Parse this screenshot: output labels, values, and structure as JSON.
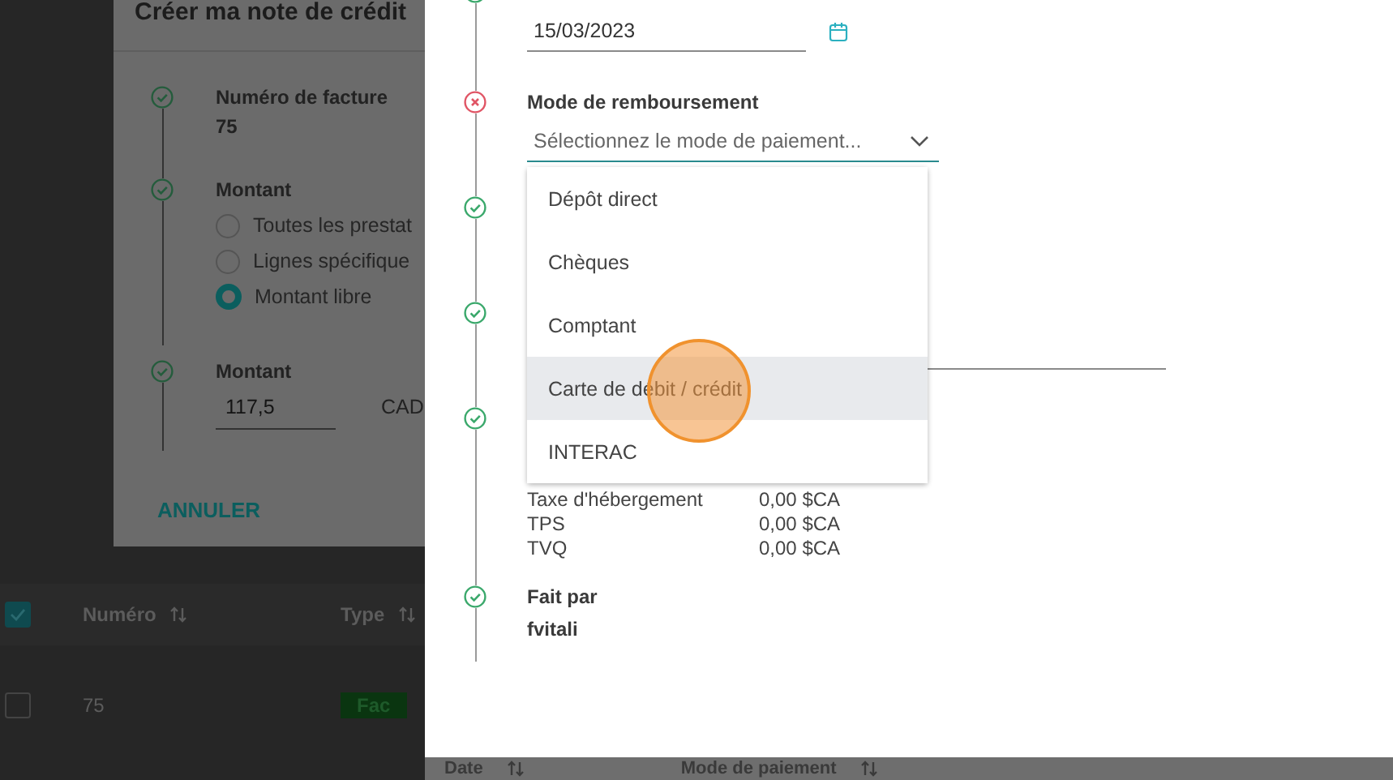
{
  "background_dialog": {
    "title": "Créer ma note de crédit",
    "steps": [
      {
        "kind": "text",
        "valid": true,
        "label": "Numéro de facture",
        "value": "75"
      },
      {
        "kind": "radio",
        "valid": true,
        "label": "Montant",
        "options": [
          {
            "label": "Toutes les prestat",
            "selected": false
          },
          {
            "label": "Lignes spécifique",
            "selected": false
          },
          {
            "label": "Montant libre",
            "selected": true
          }
        ]
      },
      {
        "kind": "amount",
        "valid": true,
        "label": "Montant",
        "value": "117,5",
        "currency": "CAD"
      }
    ],
    "cancel_button": "ANNULER"
  },
  "background_table": {
    "select_all_checked": true,
    "columns": [
      "Numéro",
      "Type"
    ],
    "rows": [
      {
        "checked": false,
        "number": "75",
        "type": "Fac"
      }
    ]
  },
  "panel": {
    "steps": [
      {
        "kind": "date",
        "valid": true,
        "value": "15/03/2023"
      },
      {
        "kind": "select",
        "valid": false,
        "label": "Mode de remboursement",
        "placeholder": "Sélectionnez le mode de paiement..."
      },
      {
        "kind": "blank",
        "valid": true
      },
      {
        "kind": "field",
        "valid": true
      },
      {
        "kind": "taxes",
        "valid": true,
        "rows": [
          {
            "name": "Taxe d'hébergement",
            "amount": "0,00 $CA"
          },
          {
            "name": "TPS",
            "amount": "0,00 $CA"
          },
          {
            "name": "TVQ",
            "amount": "0,00 $CA"
          }
        ]
      },
      {
        "kind": "text",
        "valid": true,
        "label": "Fait par",
        "value": "fvitali"
      }
    ],
    "dropdown": {
      "options": [
        {
          "label": "Dépôt direct",
          "selected": false
        },
        {
          "label": "Chèques",
          "selected": false
        },
        {
          "label": "Comptant",
          "selected": false
        },
        {
          "label": "Carte de débit / crédit",
          "selected": true
        },
        {
          "label": "INTERAC",
          "selected": false
        }
      ]
    }
  },
  "bottom_table": {
    "columns": [
      "Date",
      "Mode de paiement"
    ]
  }
}
